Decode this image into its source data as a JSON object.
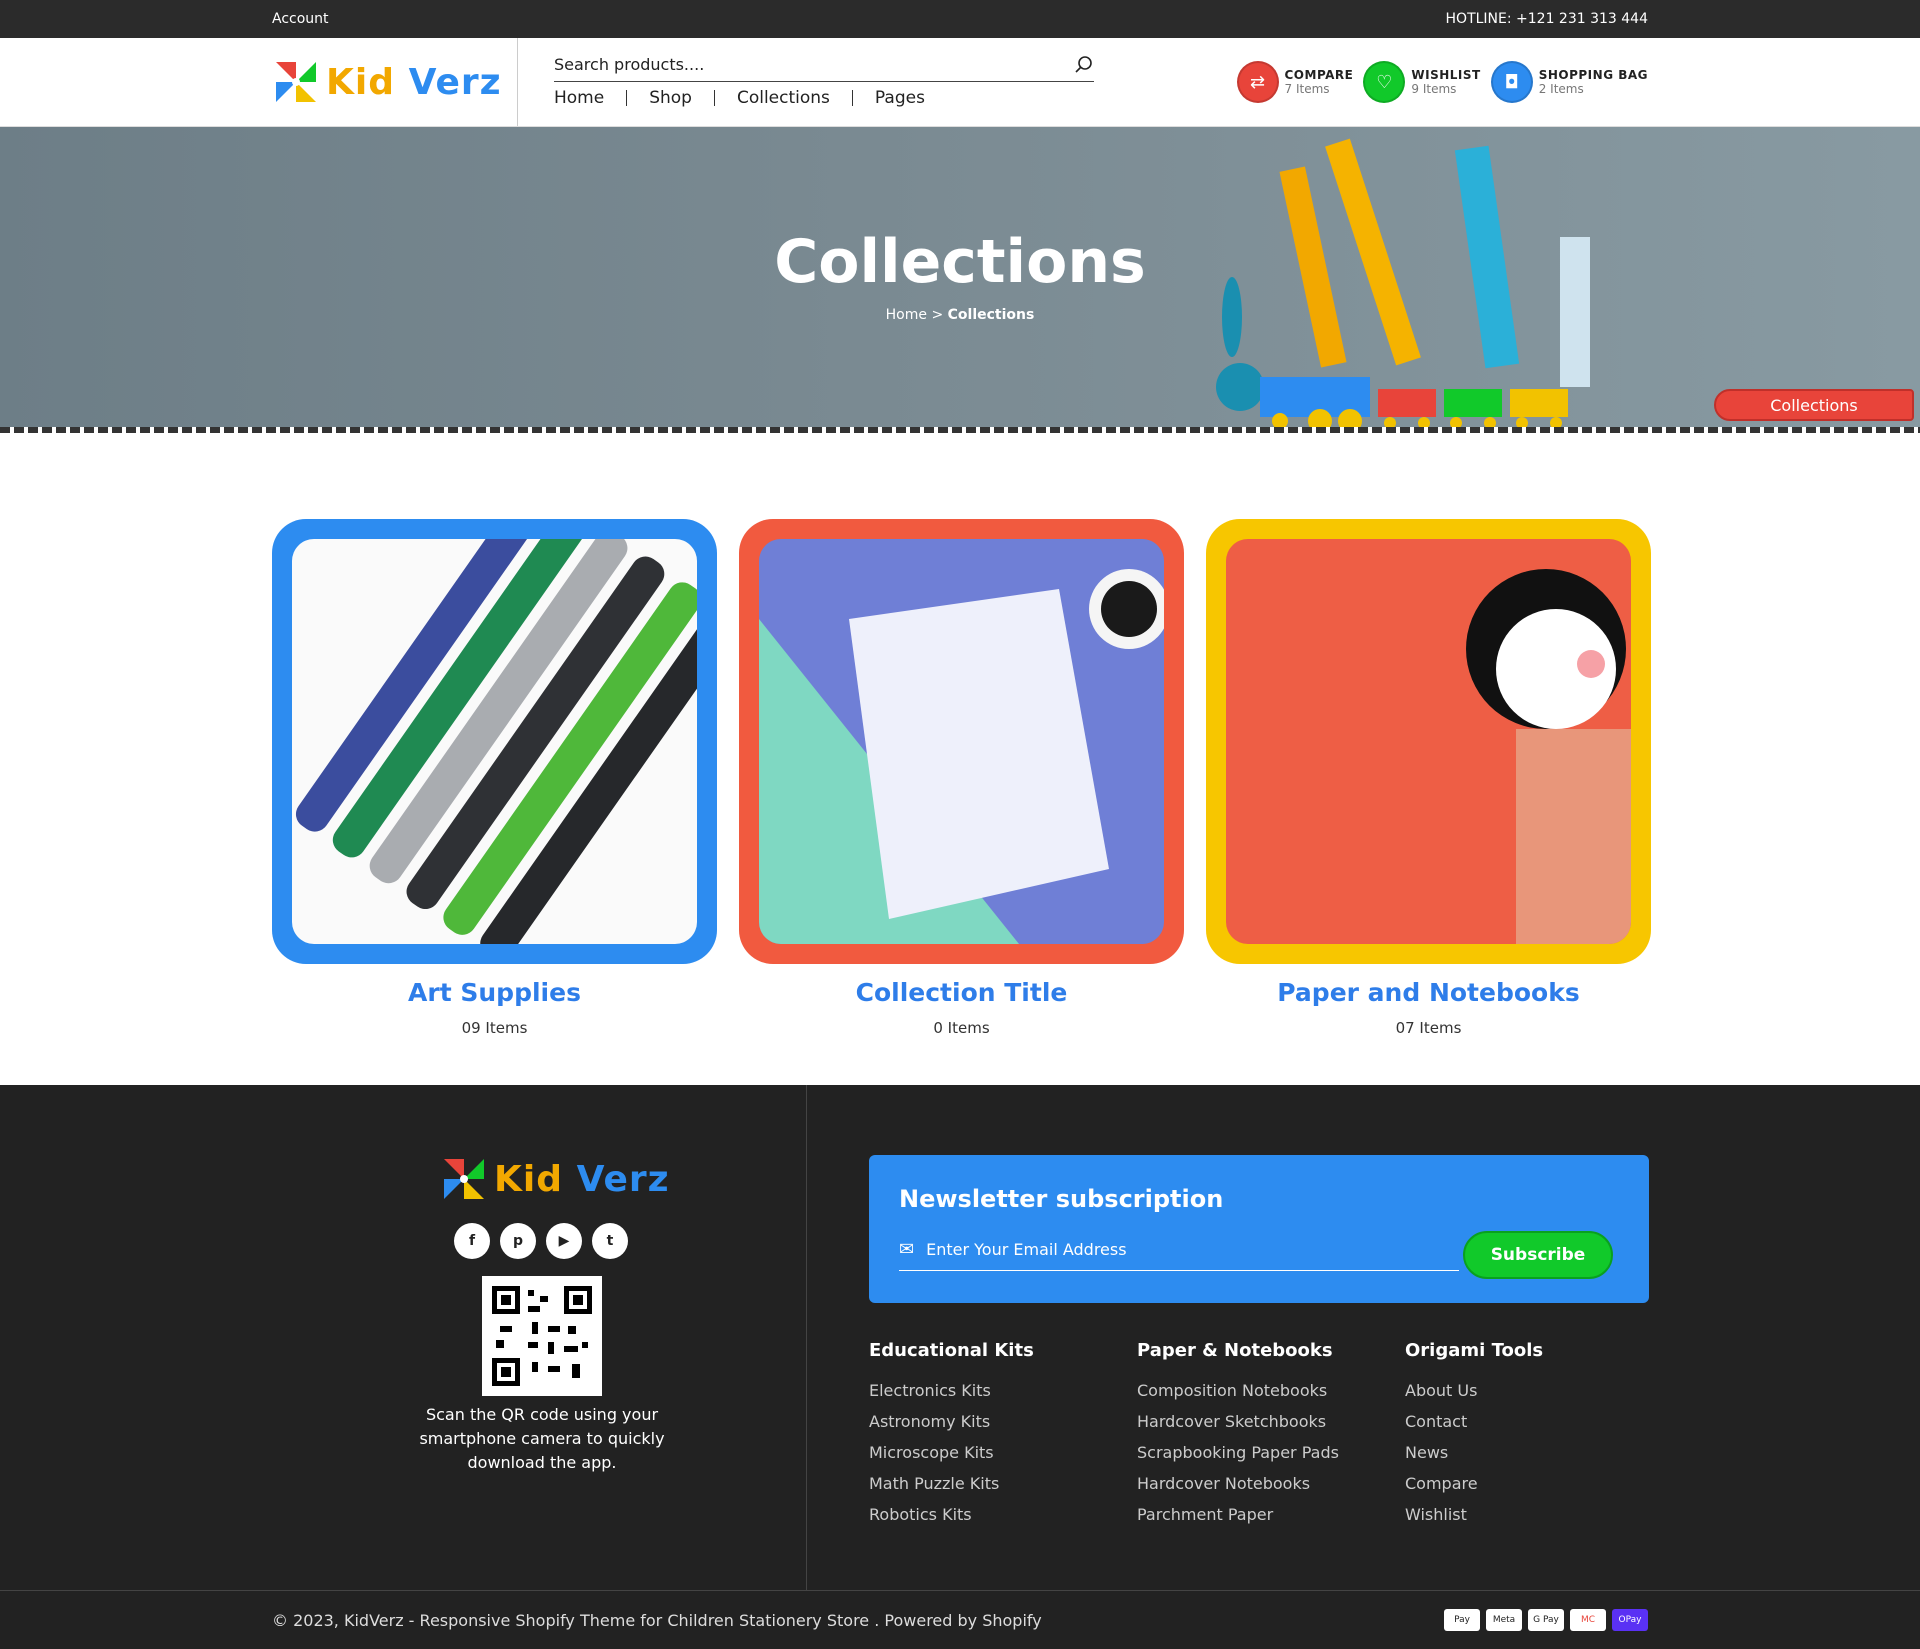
{
  "topbar": {
    "account": "Account",
    "hotline": "HOTLINE: +121 231 313 444"
  },
  "brand": {
    "name_part1": "Kid",
    "name_part2": "Verz"
  },
  "search": {
    "placeholder": "Search products...."
  },
  "nav": [
    "Home",
    "Shop",
    "Collections",
    "Pages"
  ],
  "actions": {
    "compare": {
      "label": "COMPARE",
      "count": "7 Items"
    },
    "wishlist": {
      "label": "WISHLIST",
      "count": "9 Items"
    },
    "bag": {
      "label": "SHOPPING BAG",
      "count": "2 Items"
    }
  },
  "hero": {
    "title": "Collections",
    "crumb_home": "Home",
    "crumb_sep": ">",
    "crumb_current": "Collections",
    "tag": "Collections"
  },
  "collections": [
    {
      "title": "Art Supplies",
      "count": "09 Items"
    },
    {
      "title": "Collection Title",
      "count": "0 Items"
    },
    {
      "title": "Paper and Notebooks",
      "count": "07 Items"
    }
  ],
  "footer": {
    "qr_text": "Scan the QR code using your smartphone camera to quickly download the app.",
    "newsletter_title": "Newsletter subscription",
    "email_placeholder": "Enter Your Email Address",
    "subscribe": "Subscribe",
    "col1": {
      "title": "Educational Kits",
      "links": [
        "Electronics Kits",
        "Astronomy Kits",
        "Microscope Kits",
        "Math Puzzle Kits",
        "Robotics Kits"
      ]
    },
    "col2": {
      "title": "Paper & Notebooks",
      "links": [
        "Composition Notebooks",
        "Hardcover Sketchbooks",
        "Scrapbooking Paper Pads",
        "Hardcover Notebooks",
        "Parchment Paper"
      ]
    },
    "col3": {
      "title": "Origami Tools",
      "links": [
        "About Us",
        "Contact",
        "News",
        "Compare",
        "Wishlist"
      ]
    },
    "copyright": "© 2023, KidVerz - Responsive Shopify Theme for Children Stationery Store . Powered by Shopify",
    "payments": [
      "Pay",
      "Meta",
      "G Pay",
      "MC",
      "OPay"
    ]
  }
}
